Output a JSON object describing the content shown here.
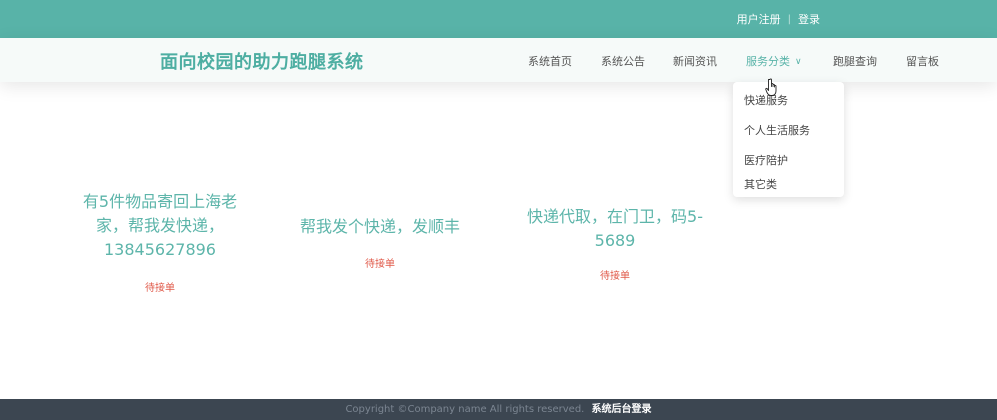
{
  "topbar": {
    "register": "用户注册",
    "separator": "|",
    "login": "登录"
  },
  "site": {
    "title": "面向校园的助力跑腿系统"
  },
  "nav": {
    "items": [
      {
        "label": "系统首页"
      },
      {
        "label": "系统公告"
      },
      {
        "label": "新闻资讯"
      },
      {
        "label": "服务分类",
        "active": true,
        "chevron": "∨"
      },
      {
        "label": "跑腿查询"
      },
      {
        "label": "留言板"
      }
    ]
  },
  "dropdown": {
    "items": [
      {
        "label": "快递服务"
      },
      {
        "label": "个人生活服务"
      },
      {
        "label": "医疗陪护"
      },
      {
        "label": "其它类"
      }
    ]
  },
  "cards": [
    {
      "title_lines": [
        "有5件物品寄回上海老",
        "家，帮我发快递，",
        "13845627896"
      ],
      "status": "待接单"
    },
    {
      "title_lines": [
        "帮我发个快递，发顺丰"
      ],
      "status": "待接单"
    },
    {
      "title_lines": [
        "快递代取，在门卫，码5-",
        "5689"
      ],
      "status": "待接单"
    }
  ],
  "footer": {
    "copyright": "Copyright ©Company name All rights reserved.",
    "admin_link": "系统后台登录"
  },
  "colors": {
    "accent": "#58b3a8",
    "title": "#4eaea2",
    "status": "#e05a4a",
    "footer_bg": "#3c4651"
  },
  "icons": {
    "cursor": "hand-pointer-icon"
  }
}
